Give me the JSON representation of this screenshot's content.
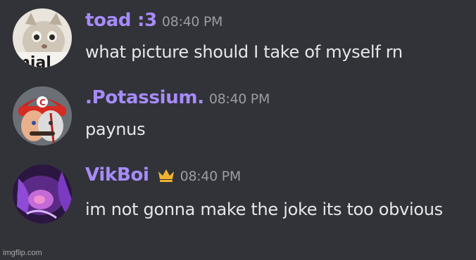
{
  "messages": [
    {
      "username": "toad :3",
      "username_color": "#a78bfa",
      "timestamp": "08:40 PM",
      "avatar_text": "mial",
      "content": "what picture should I take of myself rn"
    },
    {
      "username": ".Potassium.",
      "username_color": "#a78bfa",
      "timestamp": "08:40 PM",
      "content": "paynus"
    },
    {
      "username": "VikBoi",
      "username_color": "#a78bfa",
      "badge_icon": "crown-icon",
      "badge_color": "#f0b232",
      "timestamp": "08:40 PM",
      "content": "im not gonna make the joke its too obvious"
    }
  ],
  "watermark": "imgflip.com",
  "colors": {
    "background": "#313338",
    "text": "#e6e7ea",
    "timestamp": "#9a9ca3"
  }
}
